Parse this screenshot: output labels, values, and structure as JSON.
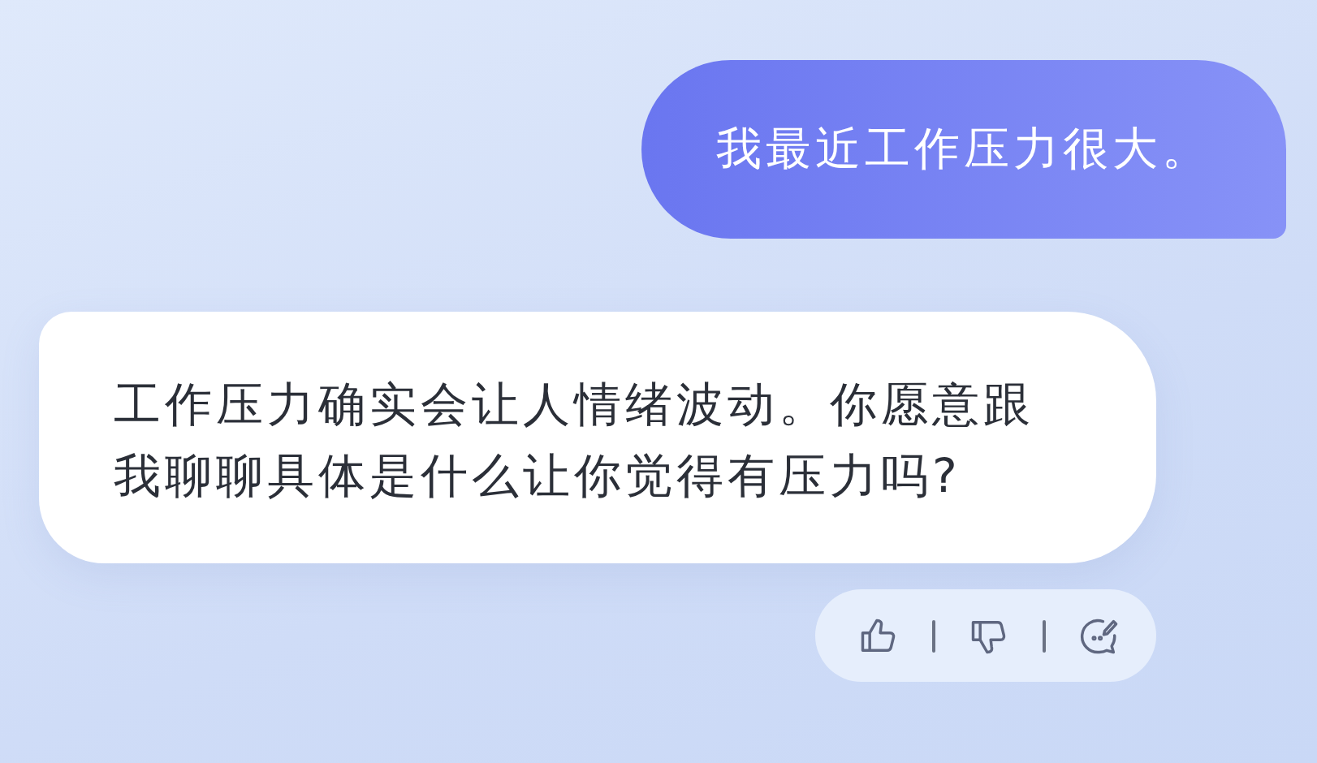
{
  "messages": [
    {
      "kind": "user",
      "text": "我最近工作压力很大。"
    },
    {
      "kind": "assistant",
      "text": "工作压力确实会让人情绪波动。你愿意跟我聊聊具体是什么让你觉得有压力吗?"
    }
  ],
  "feedback_actions": [
    {
      "kind": "like"
    },
    {
      "kind": "dislike"
    },
    {
      "kind": "comment"
    }
  ]
}
